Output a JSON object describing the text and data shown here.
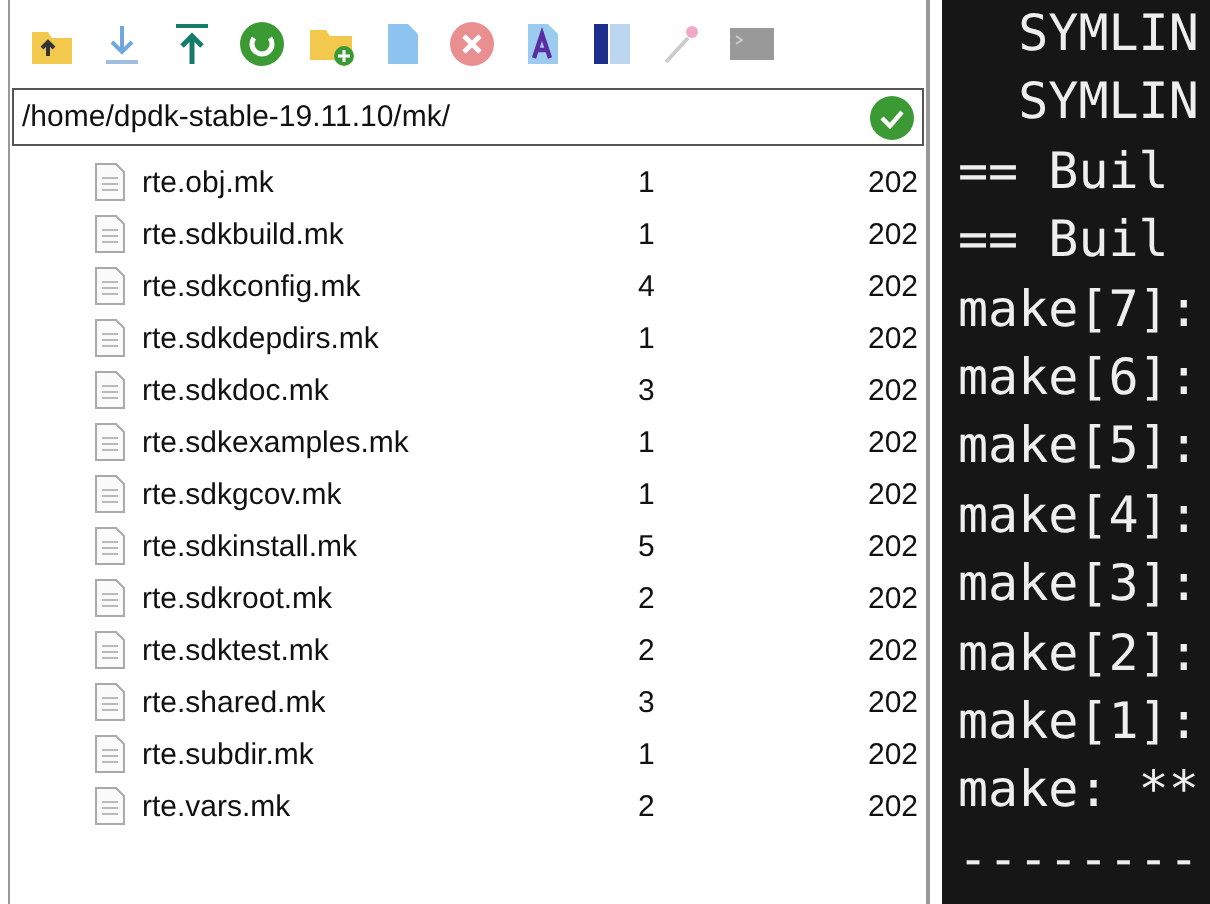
{
  "path_field": {
    "value": "/home/dpdk-stable-19.11.10/mk/"
  },
  "files": [
    {
      "name": "rte.obj.mk",
      "column_2": "1",
      "column_3": "202"
    },
    {
      "name": "rte.sdkbuild.mk",
      "column_2": "1",
      "column_3": "202"
    },
    {
      "name": "rte.sdkconfig.mk",
      "column_2": "4",
      "column_3": "202"
    },
    {
      "name": "rte.sdkdepdirs.mk",
      "column_2": "1",
      "column_3": "202"
    },
    {
      "name": "rte.sdkdoc.mk",
      "column_2": "3",
      "column_3": "202"
    },
    {
      "name": "rte.sdkexamples.mk",
      "column_2": "1",
      "column_3": "202"
    },
    {
      "name": "rte.sdkgcov.mk",
      "column_2": "1",
      "column_3": "202"
    },
    {
      "name": "rte.sdkinstall.mk",
      "column_2": "5",
      "column_3": "202"
    },
    {
      "name": "rte.sdkroot.mk",
      "column_2": "2",
      "column_3": "202"
    },
    {
      "name": "rte.sdktest.mk",
      "column_2": "2",
      "column_3": "202"
    },
    {
      "name": "rte.shared.mk",
      "column_2": "3",
      "column_3": "202"
    },
    {
      "name": "rte.subdir.mk",
      "column_2": "1",
      "column_3": "202"
    },
    {
      "name": "rte.vars.mk",
      "column_2": "2",
      "column_3": "202"
    }
  ],
  "terminal_lines": [
    "  SYMLIN",
    "  SYMLIN",
    "== Buil",
    "== Buil",
    "make[7]:",
    "make[6]:",
    "make[5]:",
    "make[4]:",
    "make[3]:",
    "make[2]:",
    "make[1]:",
    "make: **",
    "--------"
  ]
}
